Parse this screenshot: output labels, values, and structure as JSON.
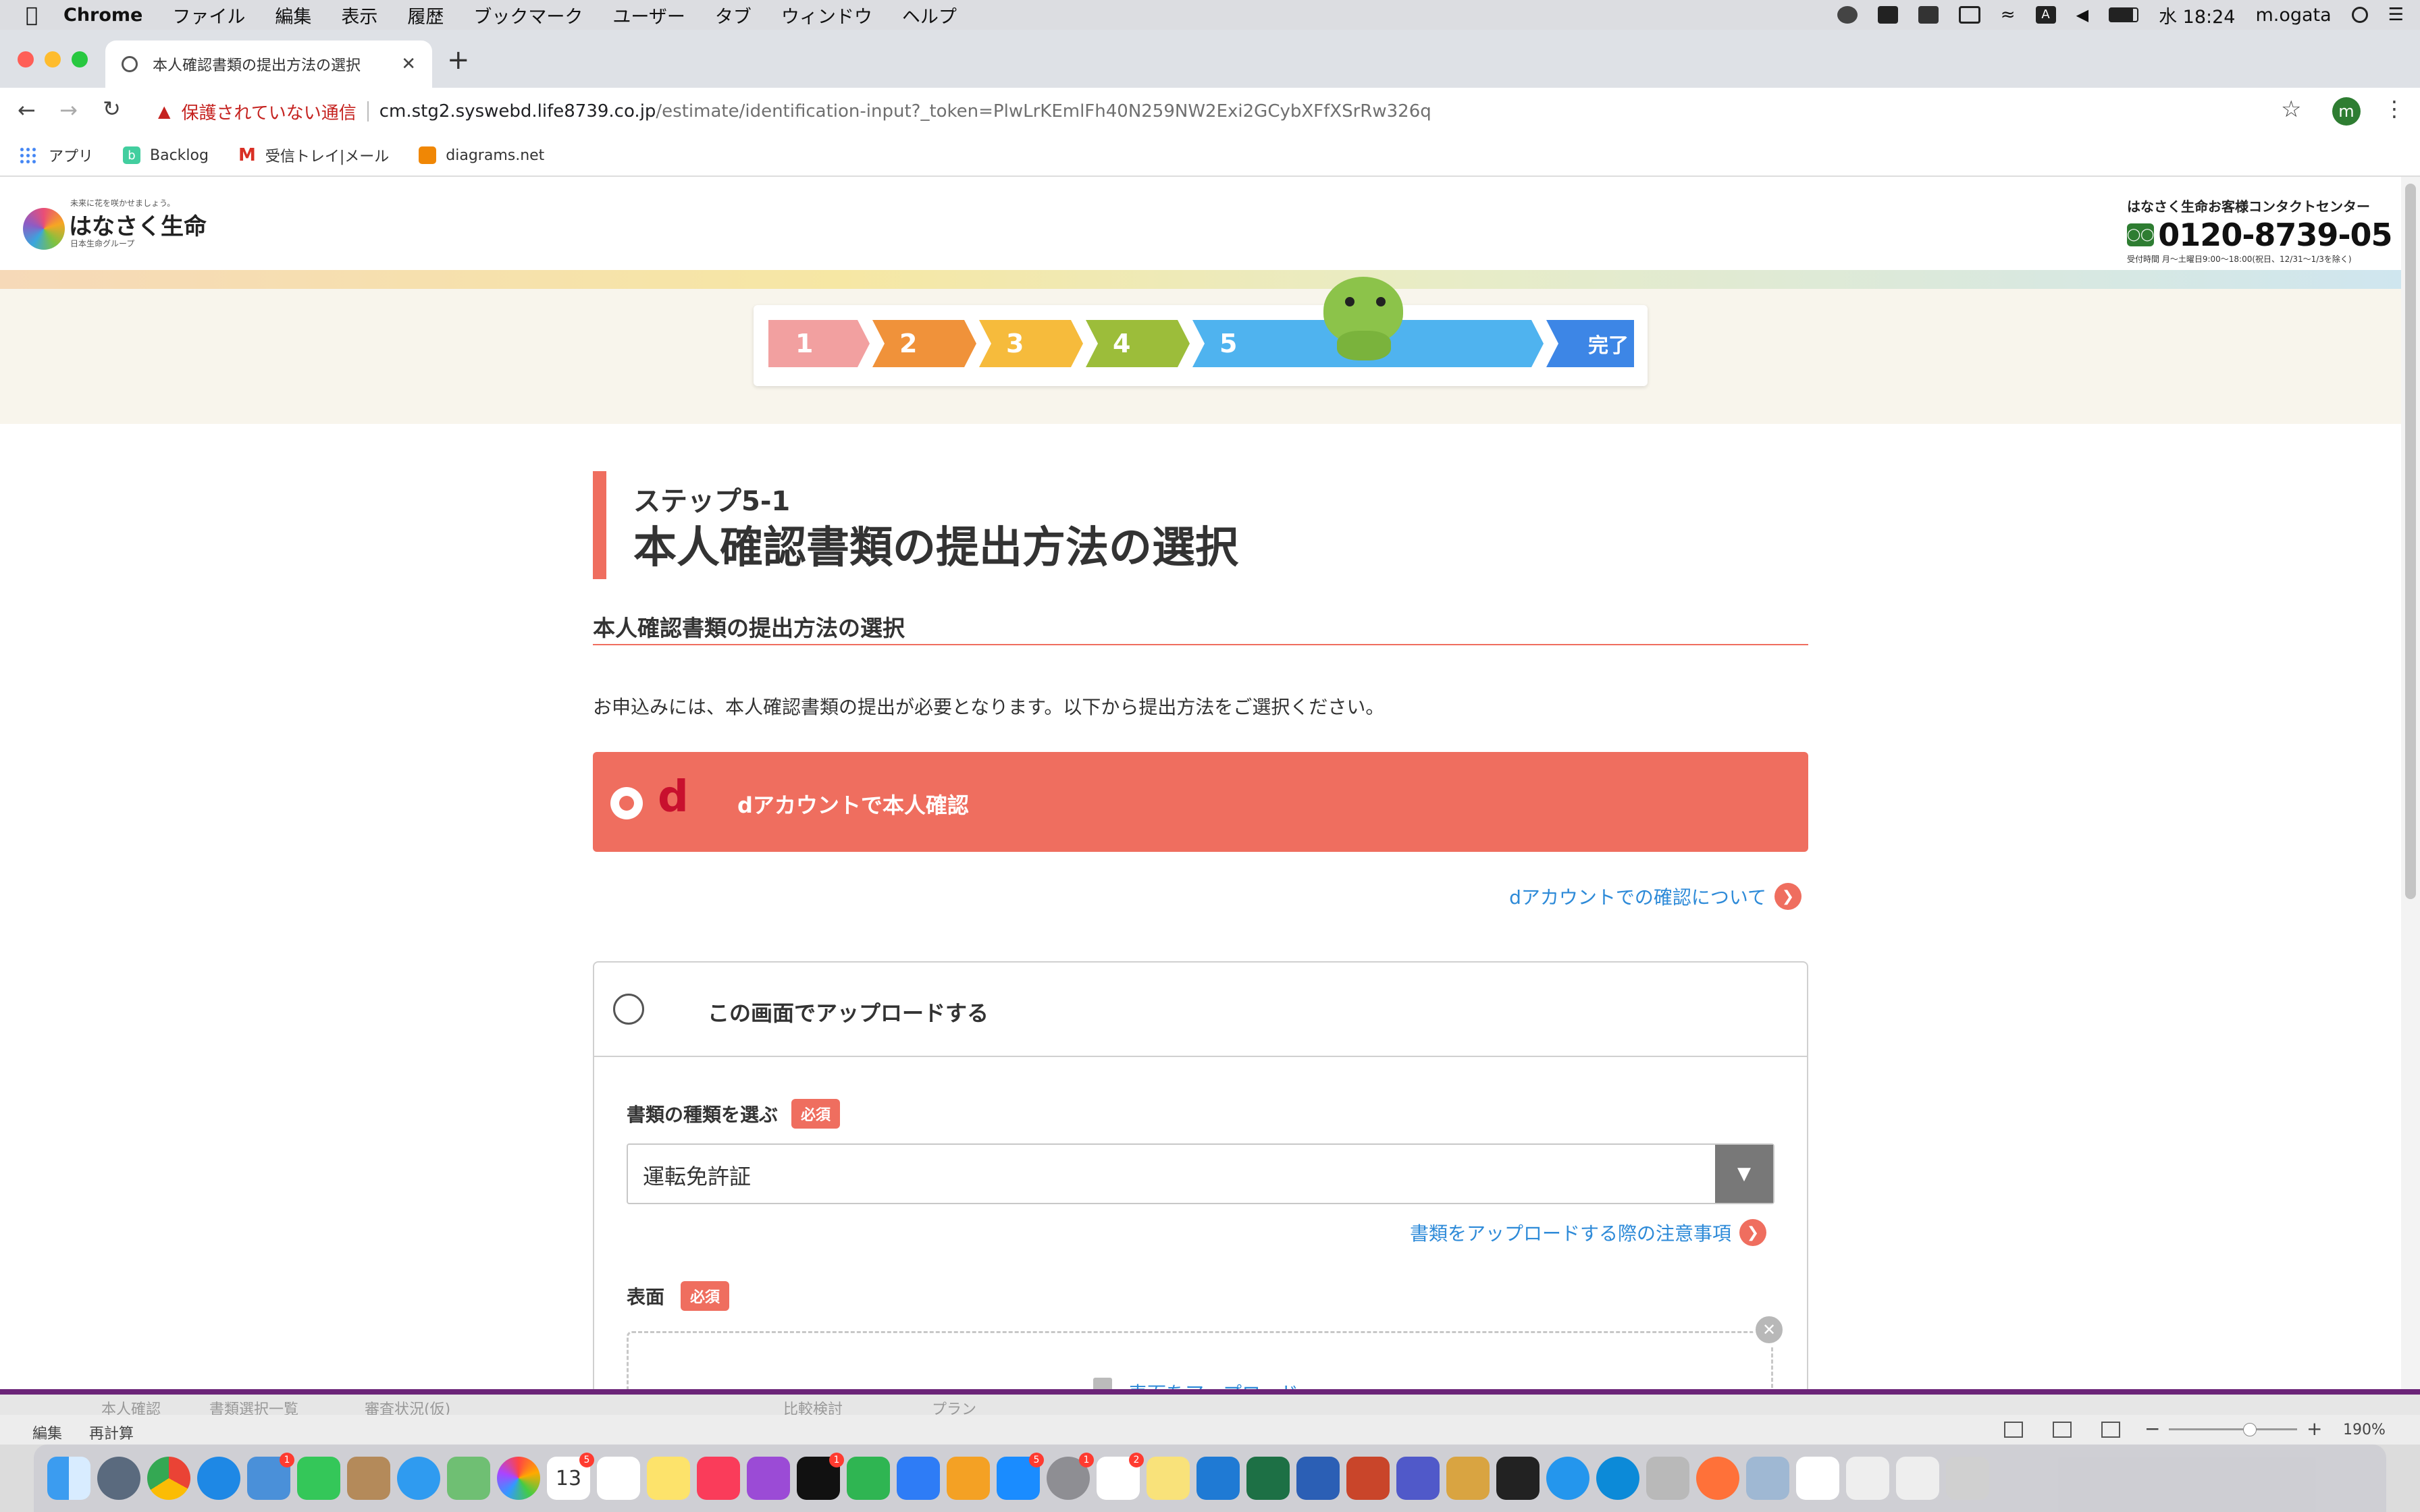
{
  "menubar": {
    "app_name": "Chrome",
    "items": [
      "ファイル",
      "編集",
      "表示",
      "履歴",
      "ブックマーク",
      "ユーザー",
      "タブ",
      "ウィンドウ",
      "ヘルプ"
    ],
    "clock": "水 18:24",
    "user": "m.ogata"
  },
  "browser": {
    "tab_title": "本人確認書類の提出方法の選択",
    "new_tab": "+",
    "security_label": "保護されていない通信",
    "url_host": "cm.stg2.syswebd.life8739.co.jp",
    "url_path": "/estimate/identification-input?_token=PlwLrKEmlFh40N259NW2Exi2GCybXFfXSrRw326q",
    "profile_initial": "m",
    "bookmarks": [
      "アプリ",
      "Backlog",
      "受信トレイ|メール",
      "diagrams.net"
    ]
  },
  "site": {
    "logo_tagline": "未来に花を咲かせましょう。",
    "logo_name": "はなさく生命",
    "logo_group": "日本生命グループ",
    "contact_title": "はなさく生命お客様コンタクトセンター",
    "phone": "0120-8739-05",
    "hours": "受付時間 月〜土曜日9:00〜18:00(祝日、12/31〜1/3を除く)"
  },
  "progress": {
    "steps": [
      "1",
      "2",
      "3",
      "4",
      "5"
    ],
    "complete": "完了",
    "current_step": 5,
    "colors": [
      "#f2a0a0",
      "#f0923a",
      "#f6bb3c",
      "#9cbd3a",
      "#4fb3ef",
      "#3d86e6"
    ]
  },
  "main": {
    "step_label": "ステップ5-1",
    "page_title": "本人確認書類の提出方法の選択",
    "section_heading": "本人確認書類の提出方法の選択",
    "intro_text": "お申込みには、本人確認書類の提出が必要となります。以下から提出方法をご選択ください。",
    "option_d_label": "dアカウントで本人確認",
    "option_d_logo": "d",
    "d_help_link": "dアカウントでの確認について",
    "option_upload_label": "この画面でアップロードする",
    "doc_type_label": "書類の種類を選ぶ",
    "required_badge": "必須",
    "doc_type_value": "運転免許証",
    "upload_notes_link": "書類をアップロードする際の注意事項",
    "front_label": "表面",
    "upload_front_text": "表面をアップロード",
    "accent": "#ef6e5f",
    "link_color": "#2d8ad8"
  },
  "excel": {
    "sheet_tabs": [
      "本人確認",
      "書類選択一覧",
      "審査状況(仮)",
      "比較検討",
      "プラン"
    ],
    "status_left": [
      "編集",
      "再計算"
    ],
    "zoom": "190%"
  },
  "dock": {
    "badges": {
      "calendar_day": "13",
      "calendar_badge": "5",
      "mail": "1",
      "tv": "1",
      "appstore": "5",
      "settings": "1",
      "slack": "2"
    }
  }
}
